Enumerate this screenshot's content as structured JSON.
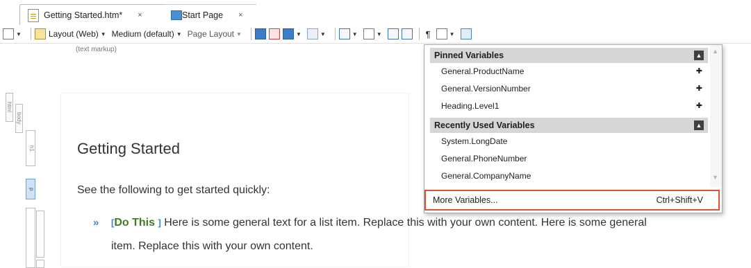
{
  "tabs": [
    {
      "label": "Getting Started.htm*",
      "close": "×"
    },
    {
      "label": "Start Page",
      "close": "×"
    }
  ],
  "toolbar": {
    "layout_label": "Layout (Web)",
    "medium_label": "Medium (default)",
    "page_layout_label": "Page Layout"
  },
  "editor": {
    "markup_label": "(text markup)",
    "tags": {
      "html": "html",
      "body": "body",
      "h1": "h1",
      "p": "p"
    },
    "heading": "Getting Started",
    "paragraph": "See the following to get started quickly:",
    "bullet_glyph": "»",
    "term": "Do This",
    "list_item_line1": "Here is some general text for a list item. Replace this with your own content. Here is some general",
    "list_item_line2": "item. Replace this with your own content."
  },
  "variables_menu": {
    "pinned_header": "Pinned Variables",
    "pinned": [
      "General.ProductName",
      "General.VersionNumber",
      "Heading.Level1"
    ],
    "recent_header": "Recently Used Variables",
    "recent": [
      "System.LongDate",
      "General.PhoneNumber",
      "General.CompanyName"
    ],
    "more_label": "More Variables...",
    "more_shortcut": "Ctrl+Shift+V"
  },
  "colors": {
    "highlight_border": "#d9532c",
    "header_bg": "#d6d6d6",
    "term_color": "#3f7b1f"
  }
}
